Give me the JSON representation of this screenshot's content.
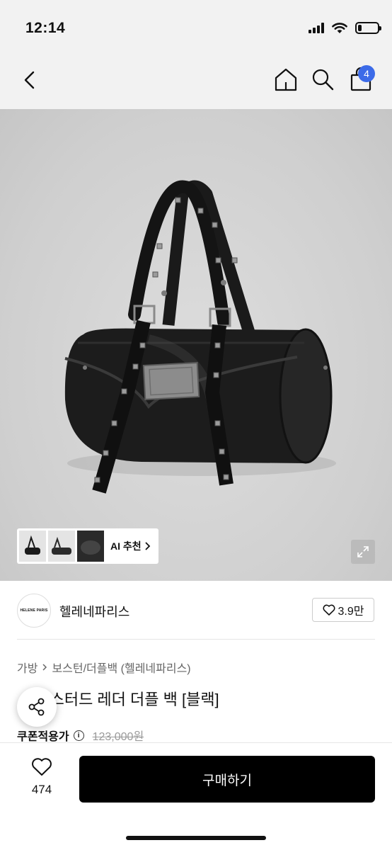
{
  "status": {
    "time": "12:14",
    "battery_level": 0.2
  },
  "nav": {
    "cart_count": "4"
  },
  "gallery": {
    "ai_label": "AI 추천"
  },
  "brand": {
    "logo_text": "HELENE PARIS",
    "name": "헬레네파리스",
    "likes": "3.9만"
  },
  "breadcrumb": {
    "category": "가방",
    "subcategory": "보스턴/더플백 (헬레네파리스)"
  },
  "product": {
    "title": "ㅤ어 스터드 레더 더플 백 [블랙]",
    "price_label": "쿠폰적용가",
    "original_price": "123,000원"
  },
  "bottom": {
    "wish_count": "474",
    "buy_label": "구매하기"
  },
  "colors": {
    "accent": "#3c6be8",
    "cta": "#000000"
  }
}
